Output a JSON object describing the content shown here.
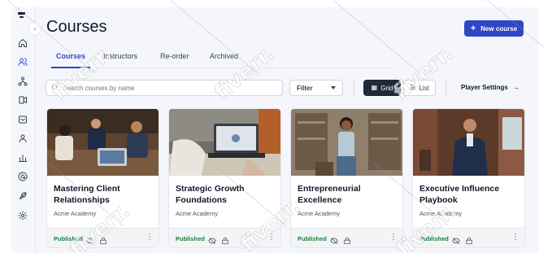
{
  "page": {
    "title": "Courses",
    "new_course_label": "New course",
    "collapse_glyph": "‹"
  },
  "tabs": [
    {
      "label": "Courses",
      "active": true
    },
    {
      "label": "Instructors",
      "active": false
    },
    {
      "label": "Re-order",
      "active": false
    },
    {
      "label": "Archived",
      "active": false
    }
  ],
  "toolbar": {
    "search_placeholder": "Search courses by name",
    "filter_label": "Filter",
    "grid_label": "Grid",
    "list_label": "List",
    "player_settings_label": "Player Settings"
  },
  "sidebar": {
    "icons": [
      "home-icon",
      "users-icon",
      "org-chart-icon",
      "video-icon",
      "inbox-icon",
      "user-icon",
      "bar-chart-icon",
      "at-sign-icon",
      "rocket-icon",
      "settings-icon"
    ],
    "active": "users-icon"
  },
  "courses": [
    {
      "title": "Mastering Client Relationships",
      "org": "Acme Academy",
      "status": "Published"
    },
    {
      "title": "Strategic Growth Foundations",
      "org": "Acme Academy",
      "status": "Published"
    },
    {
      "title": "Entrepreneurial Excellence",
      "org": "Acme Academy",
      "status": "Published"
    },
    {
      "title": "Executive Influence Playbook",
      "org": "Acme Academy",
      "status": "Published"
    }
  ],
  "watermark": "fiverr.",
  "colors": {
    "accent": "#2f46c7",
    "published": "#15803d",
    "grid_active": "#1f2937"
  }
}
